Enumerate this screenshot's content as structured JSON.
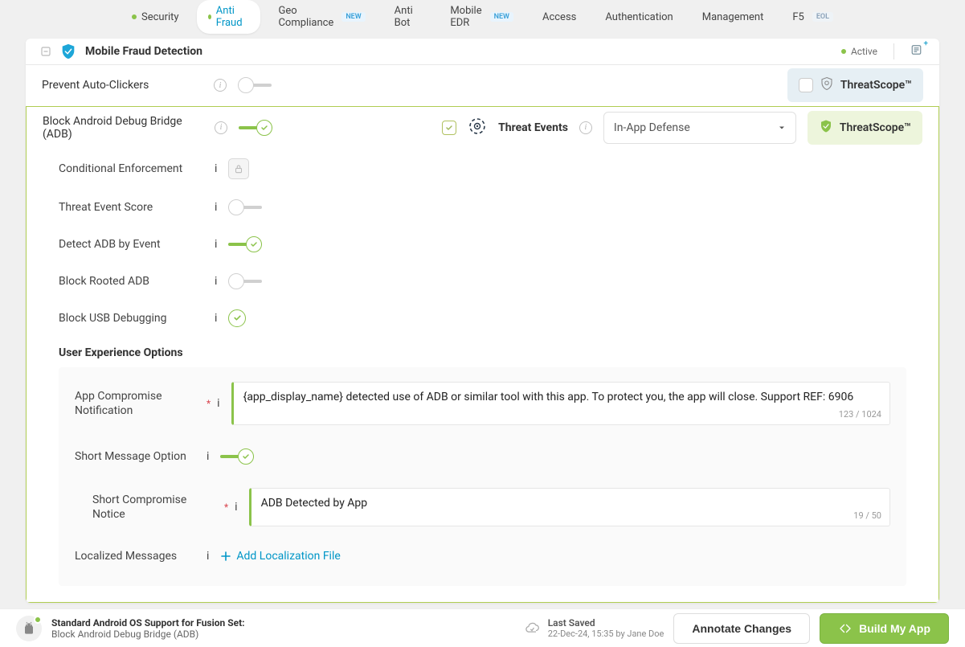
{
  "tabs": [
    {
      "label": "Security",
      "dot": true
    },
    {
      "label": "Anti Fraud",
      "dot": true,
      "active": true
    },
    {
      "label": "Geo Compliance",
      "badge": "NEW"
    },
    {
      "label": "Anti Bot"
    },
    {
      "label": "Mobile EDR",
      "badge": "NEW"
    },
    {
      "label": "Access"
    },
    {
      "label": "Authentication"
    },
    {
      "label": "Management"
    },
    {
      "label": "F5",
      "badge": "EOL"
    }
  ],
  "card": {
    "title": "Mobile Fraud Detection",
    "status": "Active"
  },
  "threatscope_label": "ThreatScope™",
  "rows": {
    "prevent_auto_clickers": "Prevent Auto-Clickers",
    "block_adb": "Block Android Debug Bridge (ADB)",
    "threat_events": "Threat Events",
    "dropdown_value": "In-App Defense",
    "conditional_enforcement": "Conditional Enforcement",
    "threat_event_score": "Threat Event Score",
    "detect_adb_by_event": "Detect ADB by Event",
    "block_rooted_adb": "Block Rooted ADB",
    "block_usb_debugging": "Block USB Debugging"
  },
  "ux": {
    "header": "User Experience Options",
    "app_compromise_notification": "App Compromise Notification",
    "notification_text": "{app_display_name} detected use of ADB or similar tool with this app. To protect you, the app will close. Support REF: 6906",
    "notification_count": "123 / 1024",
    "short_message_option": "Short Message Option",
    "short_compromise_notice": "Short Compromise Notice",
    "short_text": "ADB Detected by App",
    "short_count": "19 / 50",
    "localized_messages": "Localized Messages",
    "add_localization": "Add Localization File"
  },
  "footer": {
    "meta_title": "Standard Android OS Support for Fusion Set:",
    "meta_sub": "Block Android Debug Bridge (ADB)",
    "last_saved_label": "Last Saved",
    "last_saved_value": "22-Dec-24, 15:35 by Jane Doe",
    "annotate": "Annotate Changes",
    "build": "Build My App"
  }
}
